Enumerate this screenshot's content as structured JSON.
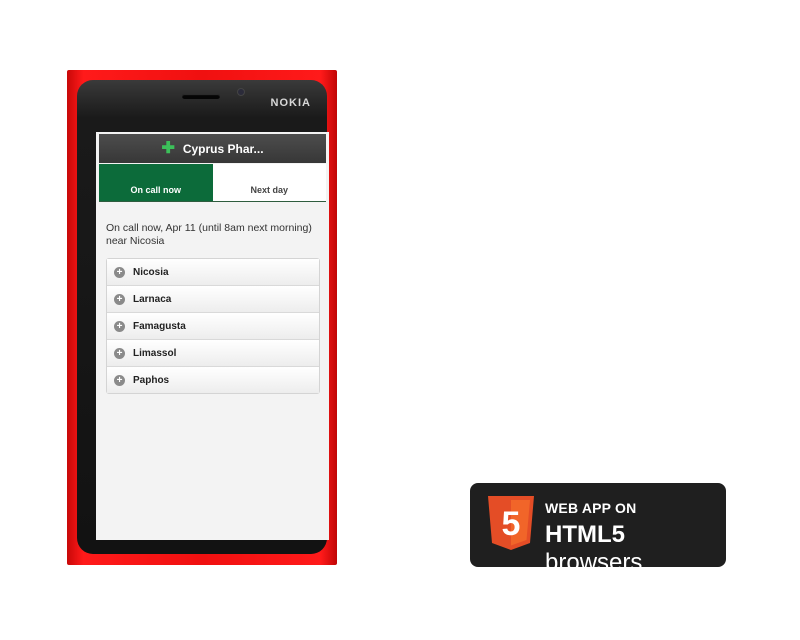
{
  "phone": {
    "brand": "NOKIA"
  },
  "app": {
    "title": "Cyprus Phar...",
    "logo_icon": "plus-icon",
    "tabs": [
      {
        "label": "On call now",
        "active": true
      },
      {
        "label": "Next day",
        "active": false
      }
    ],
    "intro": "On call now, Apr 11 (until 8am next morning) near Nicosia",
    "cities": [
      "Nicosia",
      "Larnaca",
      "Famagusta",
      "Limassol",
      "Paphos"
    ],
    "accent_color": "#0c6b3a"
  },
  "badge": {
    "line1": "WEB APP ON",
    "line2_bold": "HTML5",
    "line2_rest": "browsers",
    "shield_number": "5",
    "shield_color": "#e44d26"
  }
}
